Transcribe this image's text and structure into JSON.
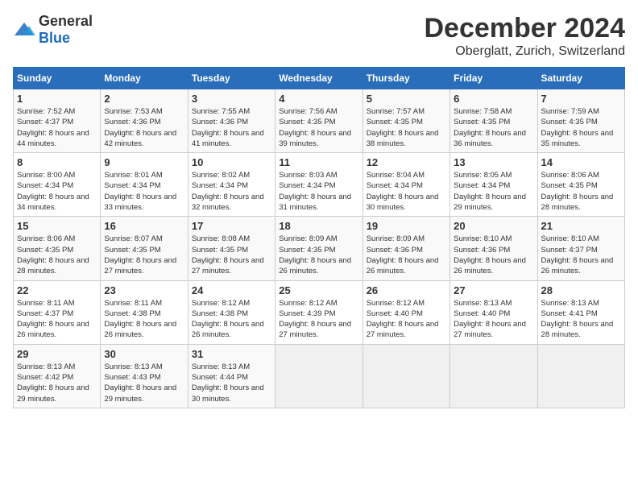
{
  "logo": {
    "general": "General",
    "blue": "Blue"
  },
  "title": {
    "month": "December 2024",
    "location": "Oberglatt, Zurich, Switzerland"
  },
  "weekdays": [
    "Sunday",
    "Monday",
    "Tuesday",
    "Wednesday",
    "Thursday",
    "Friday",
    "Saturday"
  ],
  "weeks": [
    [
      {
        "day": "1",
        "sunrise": "Sunrise: 7:52 AM",
        "sunset": "Sunset: 4:37 PM",
        "daylight": "Daylight: 8 hours and 44 minutes."
      },
      {
        "day": "2",
        "sunrise": "Sunrise: 7:53 AM",
        "sunset": "Sunset: 4:36 PM",
        "daylight": "Daylight: 8 hours and 42 minutes."
      },
      {
        "day": "3",
        "sunrise": "Sunrise: 7:55 AM",
        "sunset": "Sunset: 4:36 PM",
        "daylight": "Daylight: 8 hours and 41 minutes."
      },
      {
        "day": "4",
        "sunrise": "Sunrise: 7:56 AM",
        "sunset": "Sunset: 4:35 PM",
        "daylight": "Daylight: 8 hours and 39 minutes."
      },
      {
        "day": "5",
        "sunrise": "Sunrise: 7:57 AM",
        "sunset": "Sunset: 4:35 PM",
        "daylight": "Daylight: 8 hours and 38 minutes."
      },
      {
        "day": "6",
        "sunrise": "Sunrise: 7:58 AM",
        "sunset": "Sunset: 4:35 PM",
        "daylight": "Daylight: 8 hours and 36 minutes."
      },
      {
        "day": "7",
        "sunrise": "Sunrise: 7:59 AM",
        "sunset": "Sunset: 4:35 PM",
        "daylight": "Daylight: 8 hours and 35 minutes."
      }
    ],
    [
      {
        "day": "8",
        "sunrise": "Sunrise: 8:00 AM",
        "sunset": "Sunset: 4:34 PM",
        "daylight": "Daylight: 8 hours and 34 minutes."
      },
      {
        "day": "9",
        "sunrise": "Sunrise: 8:01 AM",
        "sunset": "Sunset: 4:34 PM",
        "daylight": "Daylight: 8 hours and 33 minutes."
      },
      {
        "day": "10",
        "sunrise": "Sunrise: 8:02 AM",
        "sunset": "Sunset: 4:34 PM",
        "daylight": "Daylight: 8 hours and 32 minutes."
      },
      {
        "day": "11",
        "sunrise": "Sunrise: 8:03 AM",
        "sunset": "Sunset: 4:34 PM",
        "daylight": "Daylight: 8 hours and 31 minutes."
      },
      {
        "day": "12",
        "sunrise": "Sunrise: 8:04 AM",
        "sunset": "Sunset: 4:34 PM",
        "daylight": "Daylight: 8 hours and 30 minutes."
      },
      {
        "day": "13",
        "sunrise": "Sunrise: 8:05 AM",
        "sunset": "Sunset: 4:34 PM",
        "daylight": "Daylight: 8 hours and 29 minutes."
      },
      {
        "day": "14",
        "sunrise": "Sunrise: 8:06 AM",
        "sunset": "Sunset: 4:35 PM",
        "daylight": "Daylight: 8 hours and 28 minutes."
      }
    ],
    [
      {
        "day": "15",
        "sunrise": "Sunrise: 8:06 AM",
        "sunset": "Sunset: 4:35 PM",
        "daylight": "Daylight: 8 hours and 28 minutes."
      },
      {
        "day": "16",
        "sunrise": "Sunrise: 8:07 AM",
        "sunset": "Sunset: 4:35 PM",
        "daylight": "Daylight: 8 hours and 27 minutes."
      },
      {
        "day": "17",
        "sunrise": "Sunrise: 8:08 AM",
        "sunset": "Sunset: 4:35 PM",
        "daylight": "Daylight: 8 hours and 27 minutes."
      },
      {
        "day": "18",
        "sunrise": "Sunrise: 8:09 AM",
        "sunset": "Sunset: 4:35 PM",
        "daylight": "Daylight: 8 hours and 26 minutes."
      },
      {
        "day": "19",
        "sunrise": "Sunrise: 8:09 AM",
        "sunset": "Sunset: 4:36 PM",
        "daylight": "Daylight: 8 hours and 26 minutes."
      },
      {
        "day": "20",
        "sunrise": "Sunrise: 8:10 AM",
        "sunset": "Sunset: 4:36 PM",
        "daylight": "Daylight: 8 hours and 26 minutes."
      },
      {
        "day": "21",
        "sunrise": "Sunrise: 8:10 AM",
        "sunset": "Sunset: 4:37 PM",
        "daylight": "Daylight: 8 hours and 26 minutes."
      }
    ],
    [
      {
        "day": "22",
        "sunrise": "Sunrise: 8:11 AM",
        "sunset": "Sunset: 4:37 PM",
        "daylight": "Daylight: 8 hours and 26 minutes."
      },
      {
        "day": "23",
        "sunrise": "Sunrise: 8:11 AM",
        "sunset": "Sunset: 4:38 PM",
        "daylight": "Daylight: 8 hours and 26 minutes."
      },
      {
        "day": "24",
        "sunrise": "Sunrise: 8:12 AM",
        "sunset": "Sunset: 4:38 PM",
        "daylight": "Daylight: 8 hours and 26 minutes."
      },
      {
        "day": "25",
        "sunrise": "Sunrise: 8:12 AM",
        "sunset": "Sunset: 4:39 PM",
        "daylight": "Daylight: 8 hours and 27 minutes."
      },
      {
        "day": "26",
        "sunrise": "Sunrise: 8:12 AM",
        "sunset": "Sunset: 4:40 PM",
        "daylight": "Daylight: 8 hours and 27 minutes."
      },
      {
        "day": "27",
        "sunrise": "Sunrise: 8:13 AM",
        "sunset": "Sunset: 4:40 PM",
        "daylight": "Daylight: 8 hours and 27 minutes."
      },
      {
        "day": "28",
        "sunrise": "Sunrise: 8:13 AM",
        "sunset": "Sunset: 4:41 PM",
        "daylight": "Daylight: 8 hours and 28 minutes."
      }
    ],
    [
      {
        "day": "29",
        "sunrise": "Sunrise: 8:13 AM",
        "sunset": "Sunset: 4:42 PM",
        "daylight": "Daylight: 8 hours and 29 minutes."
      },
      {
        "day": "30",
        "sunrise": "Sunrise: 8:13 AM",
        "sunset": "Sunset: 4:43 PM",
        "daylight": "Daylight: 8 hours and 29 minutes."
      },
      {
        "day": "31",
        "sunrise": "Sunrise: 8:13 AM",
        "sunset": "Sunset: 4:44 PM",
        "daylight": "Daylight: 8 hours and 30 minutes."
      },
      null,
      null,
      null,
      null
    ]
  ]
}
